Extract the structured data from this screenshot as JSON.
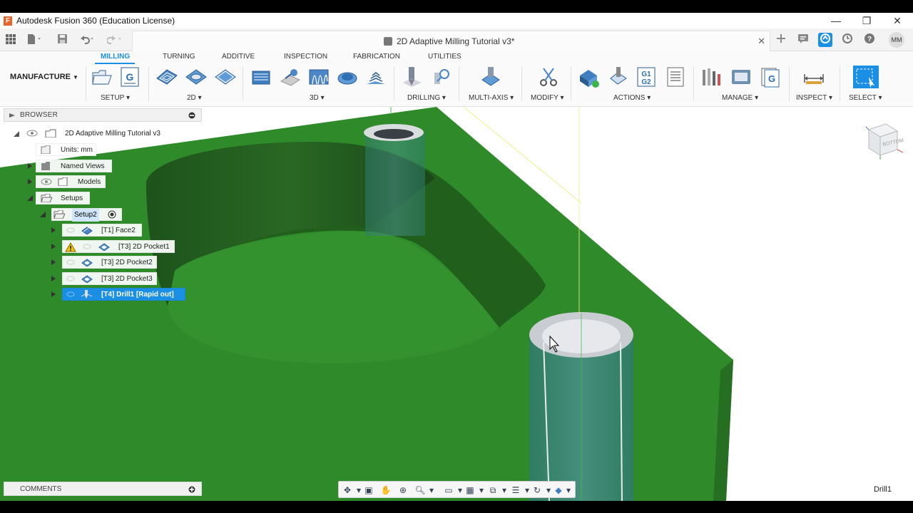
{
  "window": {
    "title": "Autodesk Fusion 360 (Education License)",
    "logo_letter": "F",
    "minimize": "—",
    "maximize": "❐",
    "close": "✕"
  },
  "document": {
    "title": "2D Adaptive Milling Tutorial v3*",
    "close": "✕",
    "user_initials": "MM"
  },
  "ribbon": {
    "workspace": "MANUFACTURE",
    "tabs": [
      "MILLING",
      "TURNING",
      "ADDITIVE",
      "INSPECTION",
      "FABRICATION",
      "UTILITIES"
    ],
    "active_tab": "MILLING",
    "groups": [
      "SETUP",
      "2D",
      "3D",
      "DRILLING",
      "MULTI-AXIS",
      "MODIFY",
      "ACTIONS",
      "MANAGE",
      "INSPECT",
      "SELECT"
    ],
    "nc_labels": [
      "G1",
      "G2"
    ],
    "nc_program_letter": "G"
  },
  "browser": {
    "title": "BROWSER",
    "items": [
      {
        "label": "2D Adaptive Milling Tutorial v3"
      },
      {
        "label": "Units: mm"
      },
      {
        "label": "Named Views"
      },
      {
        "label": "Models"
      },
      {
        "label": "Setups"
      },
      {
        "label": "Setup2"
      },
      {
        "label": "[T1] Face2"
      },
      {
        "label": "[T3] 2D Pocket1"
      },
      {
        "label": "[T3] 2D Pocket2"
      },
      {
        "label": "[T3] 2D Pocket3"
      },
      {
        "label": "[T4] Drill1 [Rapid out]"
      }
    ]
  },
  "comments": {
    "title": "COMMENTS"
  },
  "status": {
    "text": "Drill1"
  },
  "colors": {
    "accent": "#1a8fe3",
    "part_green": "#2e8a2a",
    "warning": "#f3c400"
  }
}
